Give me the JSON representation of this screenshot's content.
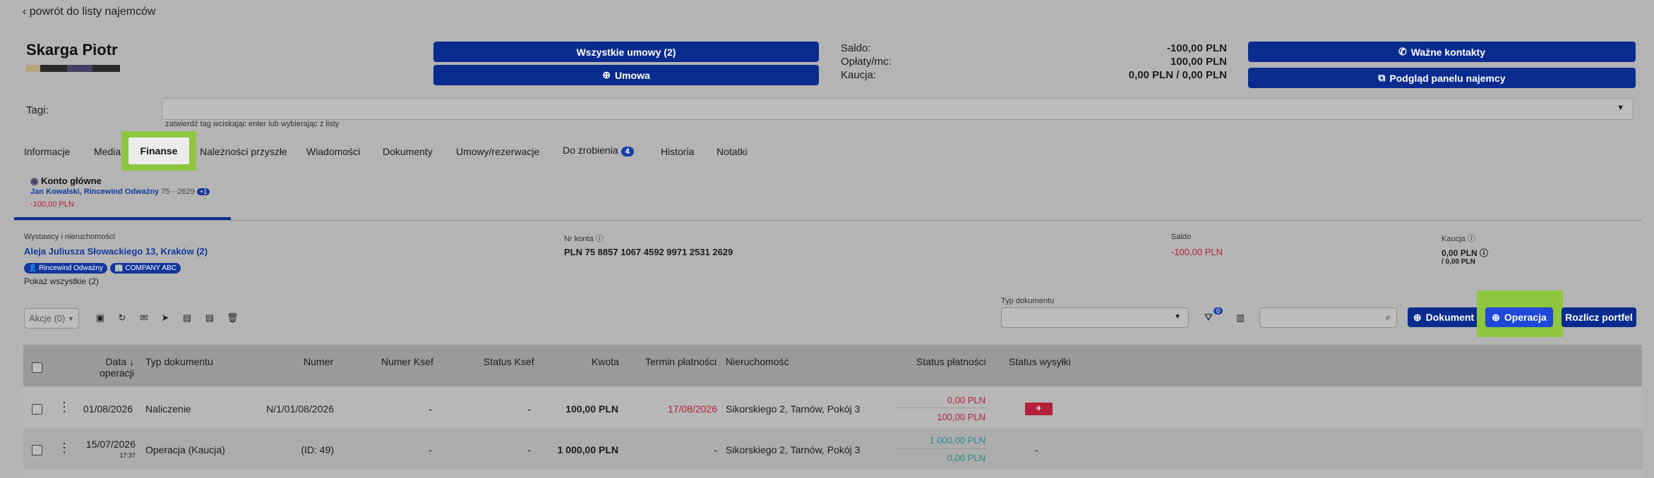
{
  "back_link": "powrót do listy najemców",
  "tenant": {
    "name": "Skarga Piotr"
  },
  "header_buttons": {
    "all_contracts": "Wszystkie umowy (2)",
    "new_contract": "Umowa",
    "important_contacts": "Ważne kontakty",
    "tenant_panel": "Podgląd panelu najemcy"
  },
  "summary": {
    "saldo_label": "Saldo:",
    "saldo_value": "-100,00 PLN",
    "fees_label": "Opłaty/mc:",
    "fees_value": "100,00 PLN",
    "deposit_label": "Kaucja:",
    "deposit_value": "0,00 PLN / 0,00 PLN"
  },
  "tags": {
    "label": "Tagi:",
    "hint": "zatwierdź tag wciskając enter lub wybierając z listy"
  },
  "tabs": {
    "informacje": "Informacje",
    "media": "Media",
    "finanse": "Finanse",
    "naleznosci": "Należności przyszłe",
    "wiadomosci": "Wiadomości",
    "dokumenty": "Dokumenty",
    "umowy": "Umowy/rezerwacje",
    "do_zrobienia": "Do zrobienia",
    "do_zrobienia_count": "4",
    "historia": "Historia",
    "notatki": "Notatki"
  },
  "account": {
    "title": "Konto główne",
    "owners": "Jan Kowalski, Rincewind Odważny",
    "number_short": "75···2629",
    "extra": "+1",
    "balance": "-100,00 PLN"
  },
  "details": {
    "exhibitors_label": "Wystawcy i nieruchomości",
    "property": "Aleja Juliusza Słowackiego 13, Kraków (2)",
    "chip_person": "Rincewind Odważny",
    "chip_company": "COMPANY ABC",
    "show_all": "Pokaż wszystkie (2)",
    "account_label": "Nr konta",
    "account_number": "PLN 75 8857 1067 4592 9971 2531 2629",
    "saldo_label": "Saldo",
    "saldo_value": "-100,00 PLN",
    "deposit_label": "Kaucja",
    "deposit_value": "0,00 PLN",
    "deposit_sub": "/ 0,00 PLN"
  },
  "toolbar": {
    "actions": "Akcje (0)",
    "doc_type_label": "Typ dokumentu",
    "filter_count": "0",
    "btn_document": "Dokument",
    "btn_operation": "Operacja",
    "btn_settle": "Rozlicz portfel"
  },
  "table": {
    "headers": {
      "date_line1": "Data",
      "date_line2": "operacji",
      "doc_type": "Typ dokumentu",
      "number": "Numer",
      "ksef_number": "Numer Ksef",
      "ksef_status": "Status Ksef",
      "amount": "Kwota",
      "due": "Termin płatności",
      "property": "Nieruchomość",
      "pay_status": "Status płatności",
      "send_status": "Status wysyłki"
    },
    "rows": [
      {
        "date": "01/08/2026",
        "time": "",
        "doc_type": "Naliczenie",
        "number": "N/1/01/08/2026",
        "ksef_number": "-",
        "ksef_status": "-",
        "amount": "100,00 PLN",
        "due": "17/08/2026",
        "property": "Sikorskiego 2, Tarnów, Pokój 3",
        "pay_top": "0,00 PLN",
        "pay_bottom": "100,00 PLN",
        "send": ""
      },
      {
        "date": "15/07/2026",
        "time": "17:37",
        "doc_type": "Operacja (Kaucja)",
        "number": "(ID: 49)",
        "ksef_number": "-",
        "ksef_status": "-",
        "amount": "1 000,00 PLN",
        "due": "-",
        "property": "Sikorskiego 2, Tarnów, Pokój 3",
        "pay_top": "1 000,00 PLN",
        "pay_bottom": "0,00 PLN",
        "send": "-"
      }
    ]
  },
  "colors": {
    "brand": "#0b2c8f",
    "highlight": "#8ec63f",
    "negative": "#b3213a",
    "teal": "#2b8a8a"
  }
}
